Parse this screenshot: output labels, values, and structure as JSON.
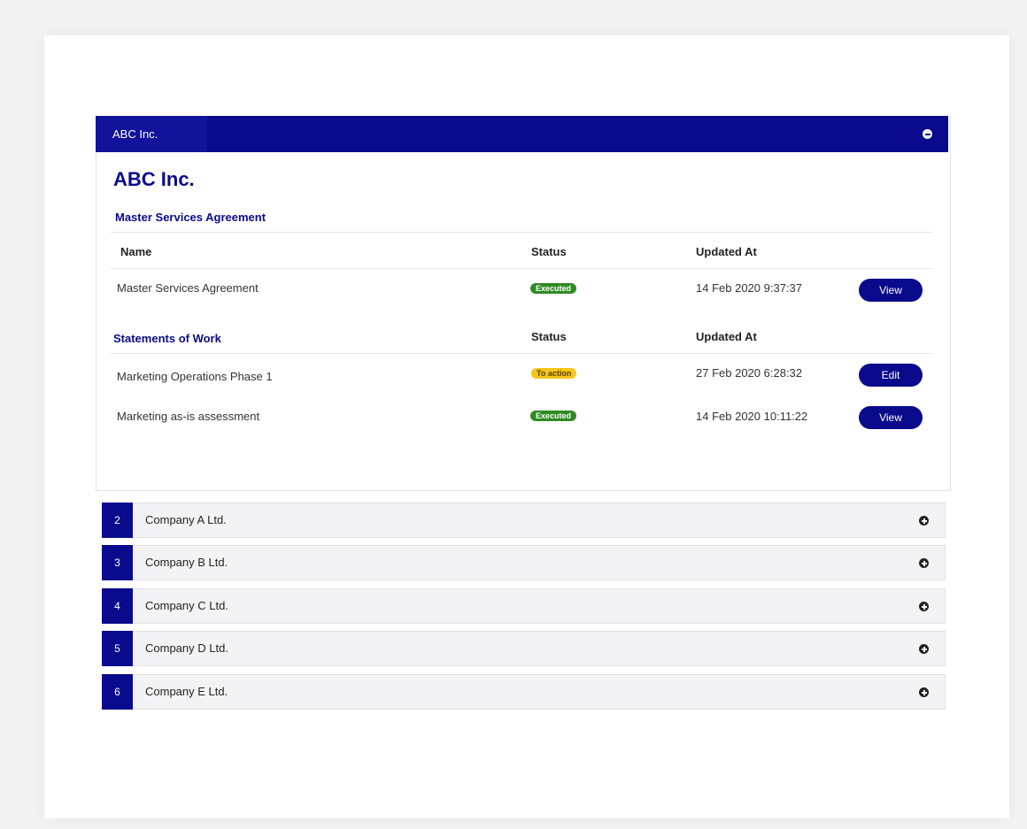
{
  "header": {
    "tab_title": "ABC Inc."
  },
  "company": {
    "title": "ABC Inc."
  },
  "msa": {
    "heading": "Master Services Agreement",
    "columns": {
      "name": "Name",
      "status": "Status",
      "updated": "Updated At"
    },
    "rows": [
      {
        "name": "Master Services Agreement",
        "status": "Executed",
        "updated": "14 Feb 2020 9:37:37",
        "action": "View"
      }
    ]
  },
  "sow": {
    "heading": "Statements of Work",
    "columns": {
      "status": "Status",
      "updated": "Updated At"
    },
    "rows": [
      {
        "name": "Marketing Operations Phase 1",
        "status": "To action",
        "updated": "27 Feb 2020 6:28:32",
        "action": "Edit"
      },
      {
        "name": "Marketing as-is assessment",
        "status": "Executed",
        "updated": "14 Feb 2020 10:11:22",
        "action": "View"
      }
    ]
  },
  "accordion": [
    {
      "number": "2",
      "label": "Company A Ltd."
    },
    {
      "number": "3",
      "label": "Company B Ltd."
    },
    {
      "number": "4",
      "label": "Company C Ltd."
    },
    {
      "number": "5",
      "label": "Company D Ltd."
    },
    {
      "number": "6",
      "label": "Company E Ltd."
    }
  ],
  "colors": {
    "brand_navy": "#0a0a8c",
    "executed_green": "#2e8b22",
    "to_action_yellow": "#f5c518",
    "page_bg": "#f3f3f4"
  },
  "icons": {
    "collapse": "minus-circle-icon",
    "expand": "plus-circle-icon"
  }
}
